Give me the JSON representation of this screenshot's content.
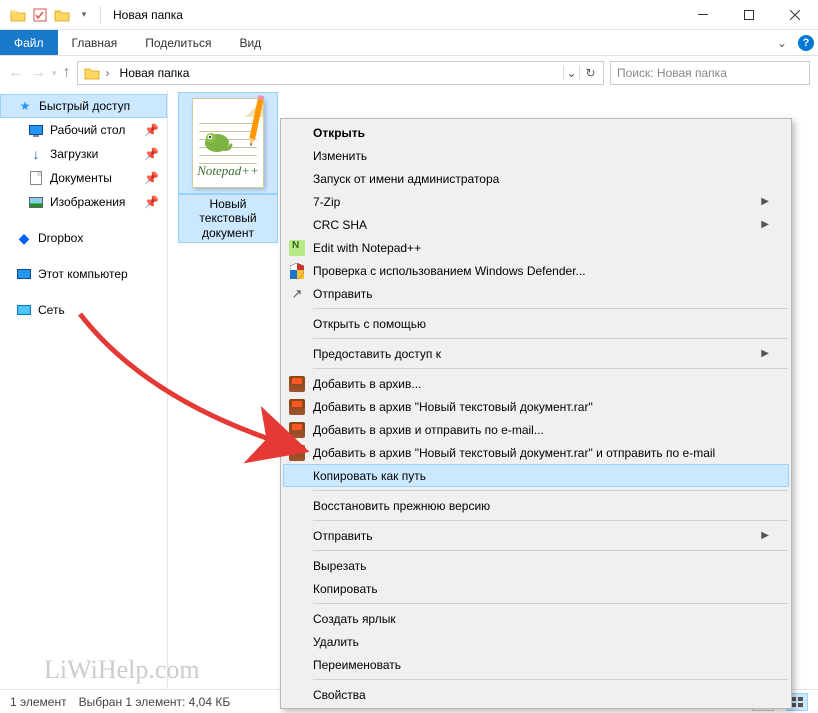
{
  "titlebar": {
    "title": "Новая папка"
  },
  "ribbon": {
    "file": "Файл",
    "home": "Главная",
    "share": "Поделиться",
    "view": "Вид"
  },
  "address": {
    "path": "Новая папка",
    "search_placeholder": "Поиск: Новая папка"
  },
  "sidebar": {
    "quick_access": "Быстрый доступ",
    "desktop": "Рабочий стол",
    "downloads": "Загрузки",
    "documents": "Документы",
    "pictures": "Изображения",
    "dropbox": "Dropbox",
    "this_pc": "Этот компьютер",
    "network": "Сеть"
  },
  "file": {
    "name": "Новый текстовый документ"
  },
  "context_menu": {
    "open": "Открыть",
    "edit": "Изменить",
    "run_as_admin": "Запуск от имени администратора",
    "seven_zip": "7-Zip",
    "crc_sha": "CRC SHA",
    "edit_npp": "Edit with Notepad++",
    "defender": "Проверка с использованием Windows Defender...",
    "send": "Отправить",
    "open_with": "Открыть с помощью",
    "give_access": "Предоставить доступ к",
    "add_archive": "Добавить в архив...",
    "add_archive_rar": "Добавить в архив \"Новый текстовый документ.rar\"",
    "add_email": "Добавить в архив и отправить по e-mail...",
    "add_rar_email": "Добавить в архив \"Новый текстовый документ.rar\" и отправить по e-mail",
    "copy_as_path": "Копировать как путь",
    "restore_prev": "Восстановить прежнюю версию",
    "send_to": "Отправить",
    "cut": "Вырезать",
    "copy": "Копировать",
    "create_shortcut": "Создать ярлык",
    "delete": "Удалить",
    "rename": "Переименовать",
    "properties": "Свойства"
  },
  "status": {
    "count": "1 элемент",
    "selection": "Выбран 1 элемент: 4,04 КБ"
  },
  "watermark": "LiWiHelp.com"
}
